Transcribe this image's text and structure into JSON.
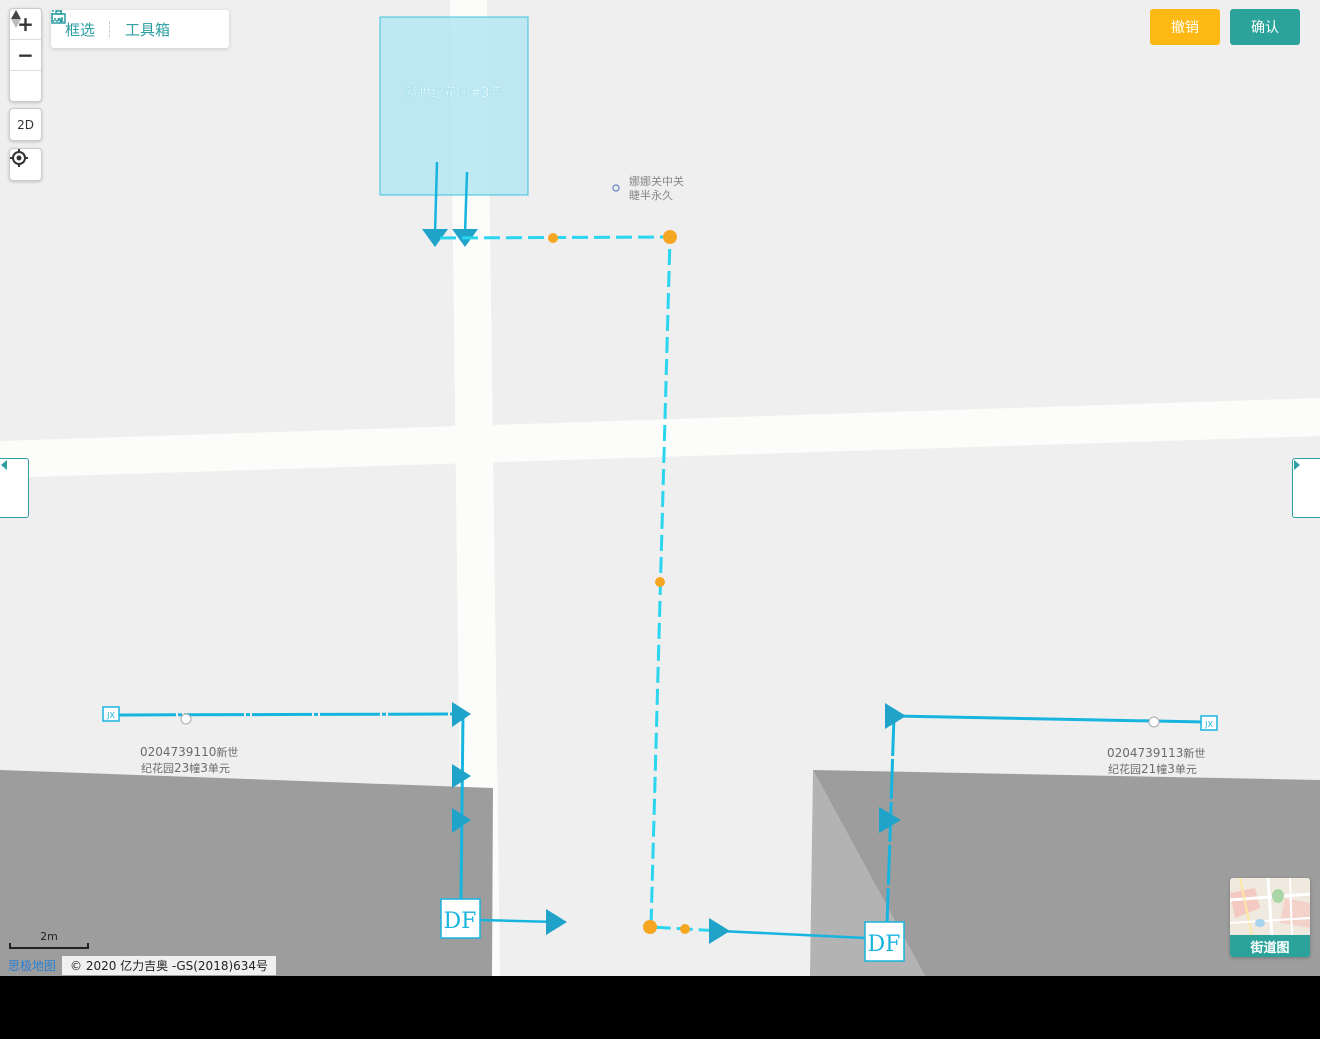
{
  "toolbar": {
    "select_label": "框选",
    "toolbox_label": "工具箱"
  },
  "zoom": {
    "in_label": "+",
    "out_label": "−",
    "compass_label": "▲"
  },
  "view_mode": {
    "label": "2D"
  },
  "actions": {
    "cancel_label": "撤销",
    "confirm_label": "确认",
    "cancel_color": "#fdb813",
    "confirm_color": "#2ba39a"
  },
  "map": {
    "substation": {
      "label": "新世纪花园#3变",
      "fill": "#b5e6f1"
    },
    "poi": {
      "line1": "娜娜关中关",
      "line2": "睫半永久"
    },
    "labels": {
      "left_unit_line1_num": "0204739110",
      "left_unit_line1_text": "新世",
      "left_unit_line2_a": "纪花园",
      "left_unit_line2_num1": "23",
      "left_unit_line2_b": "幢",
      "left_unit_line2_num2": "3",
      "left_unit_line2_c": "单元",
      "right_unit_line1_num": "0204739113",
      "right_unit_line1_text": "新世",
      "right_unit_line2_a": "纪花园",
      "right_unit_line2_num1": "21",
      "right_unit_line2_b": "幢",
      "right_unit_line2_num2": "3",
      "right_unit_line2_c": "单元",
      "df_left": "DF",
      "df_right": "DF",
      "jx_left": "JX",
      "jx_right": "JX"
    },
    "colors": {
      "line_cyan": "#18b4e0",
      "dash_cyan": "#2ad5f0",
      "node_orange": "#f5a623",
      "building_gray": "#9d9d9d",
      "road_white": "#fcfcfa"
    }
  },
  "scale": {
    "label": "2m"
  },
  "attribution": {
    "logo": "思极地图",
    "text": "© 2020 亿力吉奥 -GS(2018)634号"
  },
  "street_view": {
    "label": "街道图"
  },
  "side_tabs": {
    "left_icon": "caret-left-icon",
    "right_icon": "caret-right-icon"
  }
}
